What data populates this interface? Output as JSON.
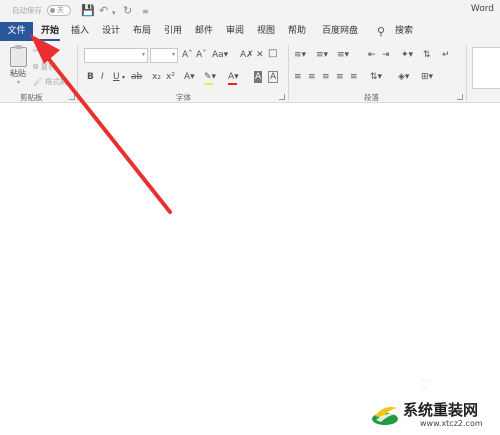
{
  "titlebar": {
    "autosave_label": "自动保存",
    "autosave_state": "关",
    "app_name": "Word"
  },
  "tabs": [
    {
      "label": "文件"
    },
    {
      "label": "开始"
    },
    {
      "label": "插入"
    },
    {
      "label": "设计"
    },
    {
      "label": "布局"
    },
    {
      "label": "引用"
    },
    {
      "label": "邮件"
    },
    {
      "label": "审阅"
    },
    {
      "label": "视图"
    },
    {
      "label": "帮助"
    },
    {
      "label": "百度网盘"
    }
  ],
  "search": {
    "label": "搜索"
  },
  "ribbon": {
    "clipboard": {
      "paste_label": "粘贴",
      "cut_label": "剪切",
      "copy_label": "复制",
      "format_painter_label": "格式刷",
      "group_label": "剪贴板"
    },
    "font": {
      "group_label": "字体"
    },
    "paragraph": {
      "group_label": "段落"
    }
  },
  "colors": {
    "accent": "#2b579a",
    "arrow": "#e8312f",
    "highlight": "#f6e94a",
    "font_color": "#e02b20"
  },
  "watermark": {
    "name": "系统重装网",
    "url": "www.xtcz2.com"
  }
}
